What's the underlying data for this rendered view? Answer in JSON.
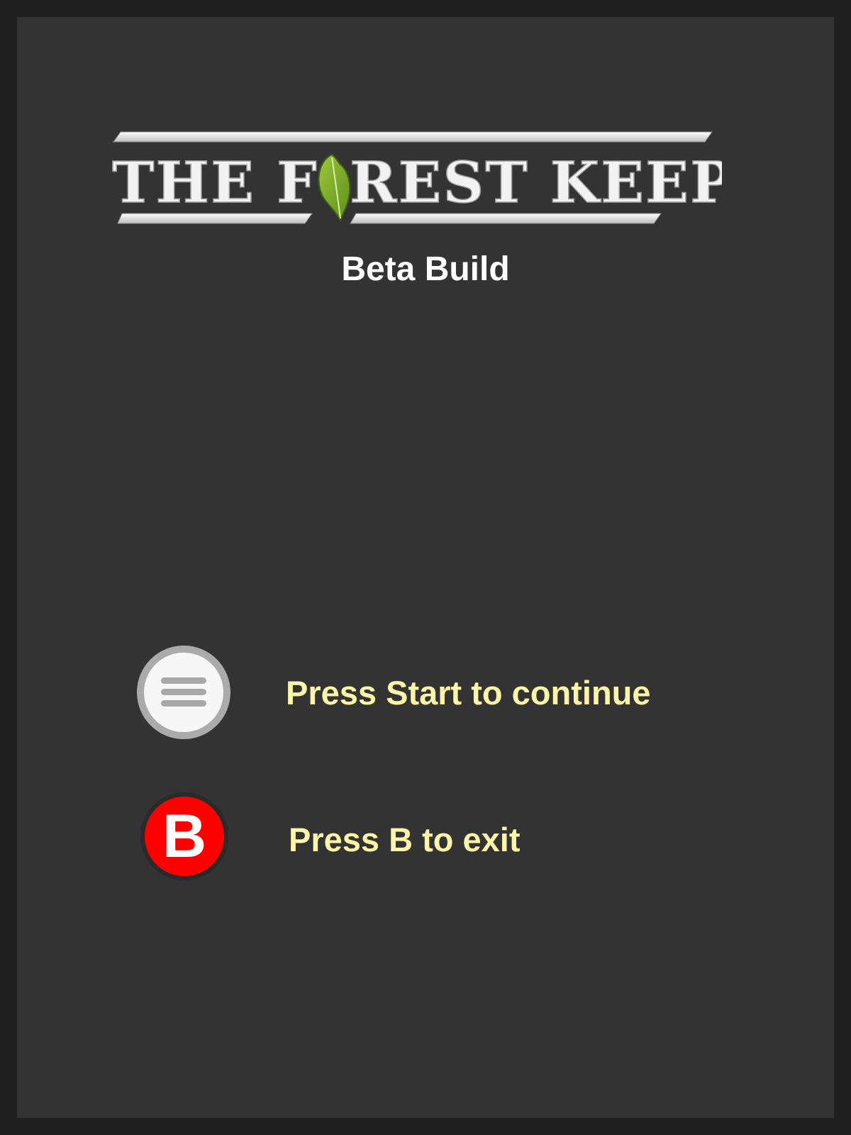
{
  "logo": {
    "title_part1": "THE F",
    "title_part2": "REST KEEPER",
    "leaf_icon": "leaf-icon"
  },
  "subtitle": "Beta Build",
  "prompts": [
    {
      "button": "Start",
      "icon": "menu-icon",
      "label": "Press Start to continue"
    },
    {
      "button": "B",
      "icon": "b-button-icon",
      "glyph": "B",
      "label": "Press B to exit"
    }
  ],
  "colors": {
    "background": "#333333",
    "prompt_text": "#fff5a8",
    "b_button": "#ff0000",
    "leaf": "#7bab2a"
  }
}
